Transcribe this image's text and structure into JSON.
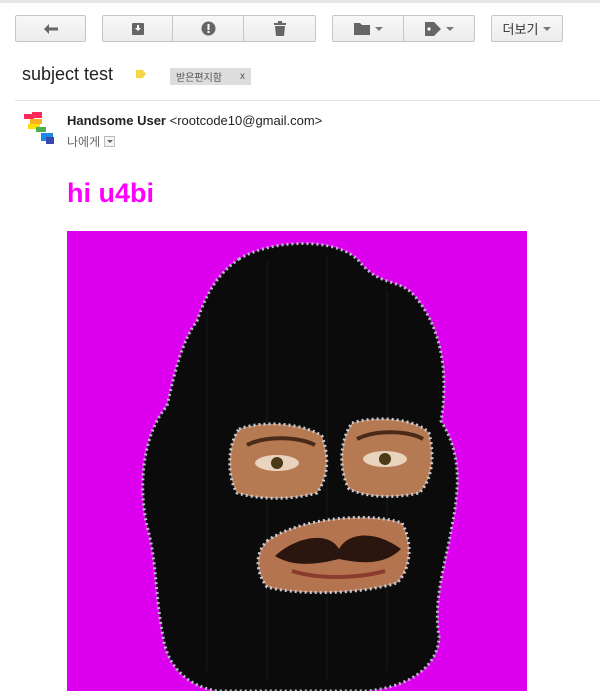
{
  "toolbar": {
    "buttons": [
      {
        "name": "reply-button",
        "icon": "reply-icon"
      },
      {
        "name": "archive-button",
        "icon": "archive-icon"
      },
      {
        "name": "report-spam-button",
        "icon": "spam-icon"
      },
      {
        "name": "delete-button",
        "icon": "trash-icon"
      },
      {
        "name": "move-to-button",
        "icon": "folder-icon"
      },
      {
        "name": "labels-button",
        "icon": "tag-icon"
      }
    ],
    "more_label": "더보기"
  },
  "message": {
    "subject": "subject test",
    "inbox_chip_label": "받은편지함",
    "inbox_chip_remove": "x",
    "sender_name": "Handsome User",
    "sender_email": "<rootcode10@gmail.com>",
    "recipient": "나에게",
    "body_heading": "hi u4bi"
  },
  "colors": {
    "body_heading": "#ff00ff",
    "image_background": "#dd00ee",
    "label_tag": "#f5d547"
  }
}
